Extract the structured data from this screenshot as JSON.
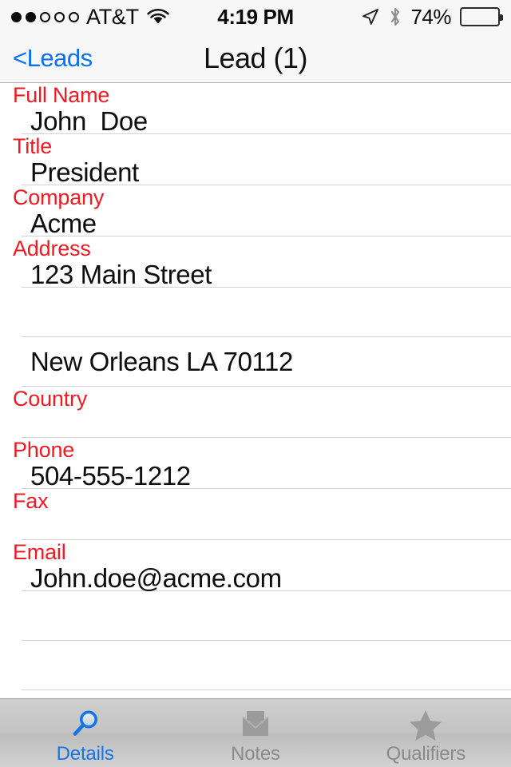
{
  "status_bar": {
    "signal_dots_total": 5,
    "signal_dots_filled": 2,
    "carrier": "AT&T",
    "wifi_icon": "wifi-icon",
    "time": "4:19 PM",
    "location_icon": "location-arrow-icon",
    "bluetooth_icon": "bluetooth-icon",
    "battery_percent_label": "74%",
    "battery_level": 74
  },
  "nav_bar": {
    "back_label": "<Leads",
    "title": "Lead (1)"
  },
  "form": {
    "rows": [
      {
        "type": "labeled",
        "label": "Full Name",
        "value": "John  Doe",
        "name": "full-name"
      },
      {
        "type": "labeled",
        "label": "Title",
        "value": "President",
        "name": "title"
      },
      {
        "type": "labeled",
        "label": "Company",
        "value": "Acme",
        "name": "company"
      },
      {
        "type": "labeled",
        "label": "Address",
        "value": "123 Main Street",
        "name": "address-line-1"
      },
      {
        "type": "empty",
        "label": "",
        "value": "",
        "name": "address-line-2"
      },
      {
        "type": "value",
        "label": "",
        "value": "New Orleans LA 70112",
        "name": "address-city-state-zip"
      },
      {
        "type": "labeled",
        "label": "Country",
        "value": "",
        "name": "country"
      },
      {
        "type": "labeled",
        "label": "Phone",
        "value": "504-555-1212",
        "name": "phone"
      },
      {
        "type": "labeled",
        "label": "Fax",
        "value": "",
        "name": "fax"
      },
      {
        "type": "labeled",
        "label": "Email",
        "value": "John.doe@acme.com",
        "name": "email"
      },
      {
        "type": "empty",
        "label": "",
        "value": "",
        "name": "extra-row-1"
      },
      {
        "type": "empty",
        "label": "",
        "value": "",
        "name": "extra-row-2"
      }
    ]
  },
  "tab_bar": {
    "tabs": [
      {
        "label": "Details",
        "icon": "magnifying-glass-icon",
        "active": true
      },
      {
        "label": "Notes",
        "icon": "envelope-icon",
        "active": false
      },
      {
        "label": "Qualifiers",
        "icon": "star-icon",
        "active": false
      }
    ]
  },
  "colors": {
    "label_red": "#ec1c24",
    "link_blue": "#0b72ef",
    "active_tab_blue": "#1674e8",
    "inactive_tab_gray": "#8a8a8a",
    "separator": "#d3d3d3",
    "bar_background": "#f7f7f7"
  }
}
